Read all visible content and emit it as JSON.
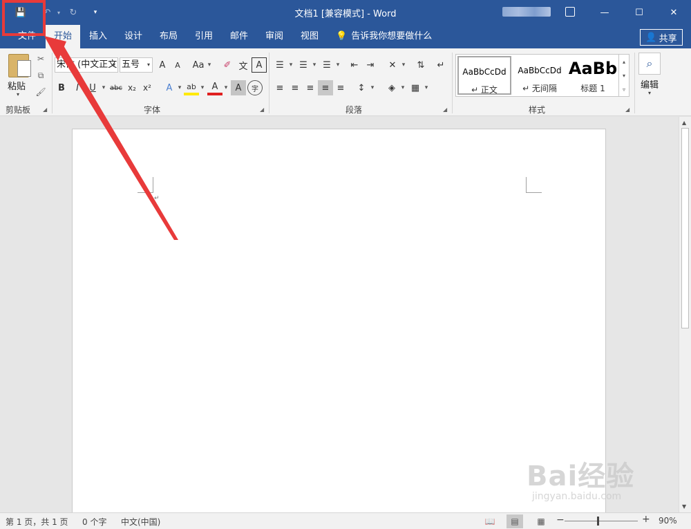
{
  "titlebar": {
    "title": "文档1 [兼容模式]  -  Word",
    "qat": {
      "save_icon": "💾",
      "undo_icon": "↶",
      "redo_icon": "↻",
      "more_icon": "▾",
      "sep": "▾"
    },
    "controls": {
      "minimize": "—",
      "maximize": "☐",
      "close": "✕"
    }
  },
  "tabs": [
    "文件",
    "开始",
    "插入",
    "设计",
    "布局",
    "引用",
    "邮件",
    "审阅",
    "视图"
  ],
  "tell_me": "告诉我你想要做什么",
  "share": "共享",
  "ribbon": {
    "clipboard": {
      "paste": "粘贴",
      "label": "剪贴板"
    },
    "font": {
      "font_name": "宋体 (中文正文)",
      "font_size": "五号",
      "grow": "A",
      "shrink": "A",
      "case": "Aa",
      "clear": "✐",
      "phonetic": "文",
      "border": "A",
      "bold": "B",
      "italic": "I",
      "underline": "U",
      "strike": "abc",
      "sub": "x₂",
      "sup": "x²",
      "effects": "A",
      "highlight": "ab",
      "color": "A",
      "shade": "A",
      "enclose": "字",
      "label": "字体"
    },
    "paragraph": {
      "label": "段落"
    },
    "styles": {
      "items": [
        {
          "sample": "AaBbCcDd",
          "name": "↵ 正文"
        },
        {
          "sample": "AaBbCcDd",
          "name": "↵ 无间隔"
        },
        {
          "sample": "AaBb",
          "name": "标题 1"
        }
      ],
      "label": "样式"
    },
    "editing": {
      "label": "编辑",
      "icon": "⌕"
    }
  },
  "document": {
    "para_mark": "↵"
  },
  "statusbar": {
    "page": "第 1 页，共 1 页",
    "words": "0 个字",
    "language": "中文(中国)",
    "zoom_minus": "−",
    "zoom_plus": "+",
    "zoom": "90%"
  },
  "watermark": {
    "main": "Bai经验",
    "sub": "jingyan.baidu.com"
  },
  "colors": {
    "title_blue": "#2b579a",
    "annotation_red": "#e83a3a"
  }
}
